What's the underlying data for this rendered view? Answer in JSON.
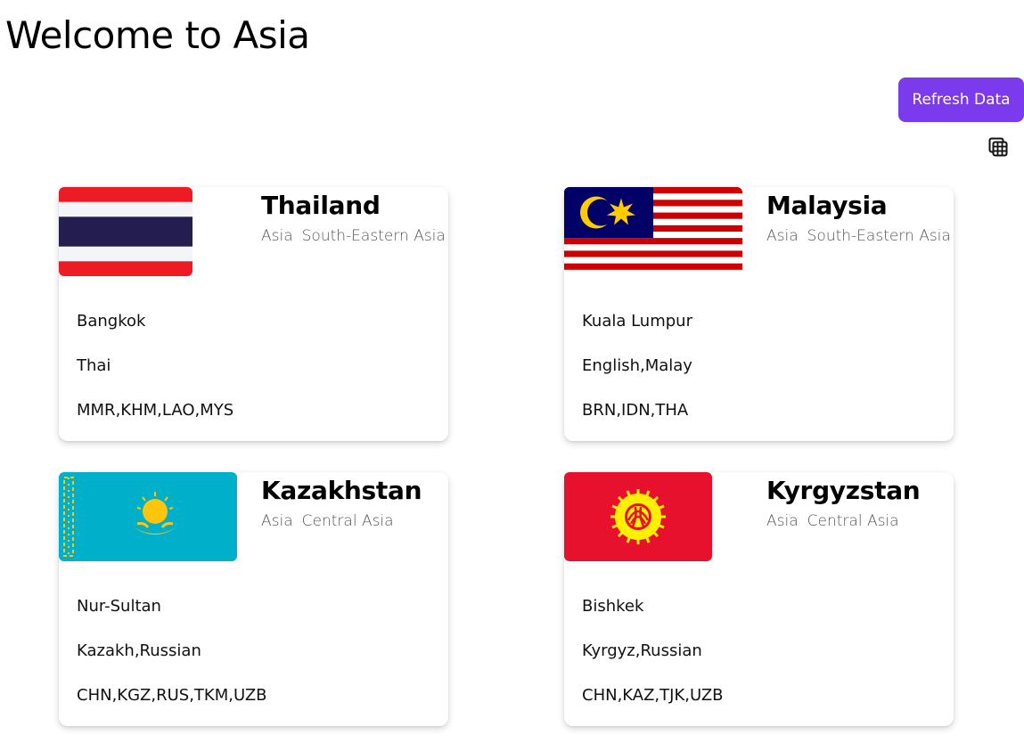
{
  "page": {
    "title": "Welcome to Asia",
    "refresh_label": "Refresh Data",
    "view_toggle_icon": "grid-view-icon"
  },
  "countries": [
    {
      "name": "Thailand",
      "region": "Asia",
      "subregion": "South-Eastern Asia",
      "capital": "Bangkok",
      "languages": "Thai",
      "borders": "MMR,KHM,LAO,MYS",
      "flag_icon": "thailand-flag"
    },
    {
      "name": "Malaysia",
      "region": "Asia",
      "subregion": "South-Eastern Asia",
      "capital": "Kuala Lumpur",
      "languages": "English,Malay",
      "borders": "BRN,IDN,THA",
      "flag_icon": "malaysia-flag"
    },
    {
      "name": "Kazakhstan",
      "region": "Asia",
      "subregion": "Central Asia",
      "capital": "Nur-Sultan",
      "languages": "Kazakh,Russian",
      "borders": "CHN,KGZ,RUS,TKM,UZB",
      "flag_icon": "kazakhstan-flag"
    },
    {
      "name": "Kyrgyzstan",
      "region": "Asia",
      "subregion": "Central Asia",
      "capital": "Bishkek",
      "languages": "Kyrgyz,Russian",
      "borders": "CHN,KAZ,TJK,UZB",
      "flag_icon": "kyrgyzstan-flag"
    }
  ],
  "colors": {
    "accent": "#7c3aed",
    "thai_red": "#ed1c24",
    "thai_blue": "#241d4f",
    "malay_red": "#cc0001",
    "malay_blue": "#010066",
    "malay_yellow": "#ffcc00",
    "kaz_blue": "#00afca",
    "kaz_yellow": "#fec50c",
    "kyr_red": "#e8112d",
    "kyr_yellow": "#ffef00"
  }
}
